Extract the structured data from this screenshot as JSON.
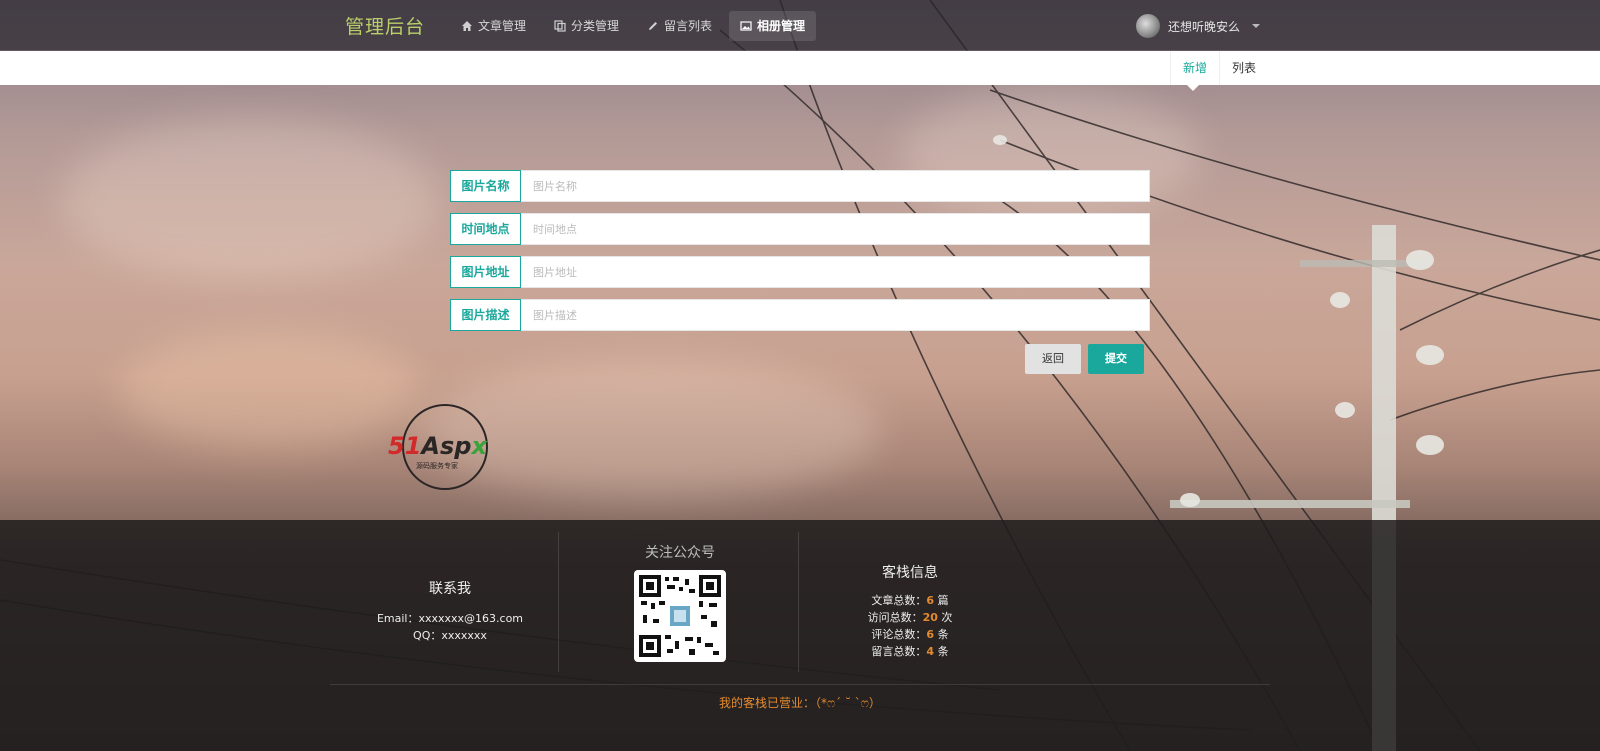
{
  "nav": {
    "brand": "管理后台",
    "items": [
      {
        "label": "文章管理",
        "icon": "home-icon"
      },
      {
        "label": "分类管理",
        "icon": "copy-icon"
      },
      {
        "label": "留言列表",
        "icon": "pencil-icon"
      },
      {
        "label": "相册管理",
        "icon": "image-icon"
      }
    ],
    "active_index": 3,
    "username": "还想听晚安么"
  },
  "tabs": {
    "new_label": "新增",
    "list_label": "列表"
  },
  "form": {
    "fields": [
      {
        "label": "图片名称",
        "placeholder": "图片名称",
        "value": ""
      },
      {
        "label": "时间地点",
        "placeholder": "时间地点",
        "value": ""
      },
      {
        "label": "图片地址",
        "placeholder": "图片地址",
        "value": ""
      },
      {
        "label": "图片描述",
        "placeholder": "图片描述",
        "value": ""
      }
    ],
    "back_label": "返回",
    "submit_label": "提交"
  },
  "logo": {
    "text": "51Aspx",
    "tagline": "源码服务专家"
  },
  "footer": {
    "contact": {
      "title": "联系我",
      "email": "Email：xxxxxxx@163.com",
      "qq": "QQ：xxxxxxx"
    },
    "wechat": {
      "title": "关注公众号"
    },
    "stats": {
      "title": "客栈信息",
      "rows": [
        {
          "label": "文章总数：",
          "value": "6",
          "unit": "篇"
        },
        {
          "label": "访问总数：",
          "value": "20",
          "unit": "次"
        },
        {
          "label": "评论总数：",
          "value": "6",
          "unit": "条"
        },
        {
          "label": "留言总数：",
          "value": "4",
          "unit": "条"
        }
      ]
    },
    "bottom_text": "我的客栈已营业：（*ෆ´ ˘ `ෆ）"
  },
  "colors": {
    "accent": "#1aa89c",
    "brand": "#b9cf6a",
    "highlight": "#e38a2e"
  }
}
